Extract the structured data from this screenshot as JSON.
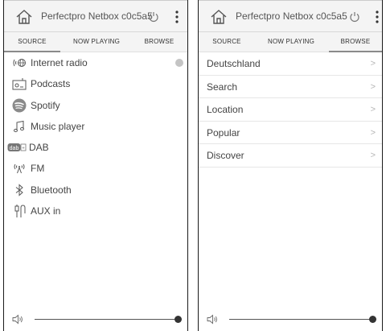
{
  "app": {
    "title": "Perfectpro Netbox c0c5a5"
  },
  "tabs": {
    "source": "SOURCE",
    "now_playing": "NOW PLAYING",
    "browse": "BROWSE"
  },
  "left": {
    "active_tab": "source",
    "sources": [
      {
        "label": "Internet radio",
        "icon": "internet-radio-icon",
        "active": true
      },
      {
        "label": "Podcasts",
        "icon": "podcasts-icon"
      },
      {
        "label": "Spotify",
        "icon": "spotify-icon"
      },
      {
        "label": "Music player",
        "icon": "music-note-icon"
      },
      {
        "label": "DAB",
        "icon": "dab-icon"
      },
      {
        "label": "FM",
        "icon": "fm-antenna-icon"
      },
      {
        "label": "Bluetooth",
        "icon": "bluetooth-icon"
      },
      {
        "label": "AUX in",
        "icon": "aux-in-icon"
      }
    ],
    "volume_level": 1.0
  },
  "right": {
    "active_tab": "browse",
    "browse_items": [
      {
        "label": "Deutschland"
      },
      {
        "label": "Search"
      },
      {
        "label": "Location"
      },
      {
        "label": "Popular"
      },
      {
        "label": "Discover"
      }
    ],
    "chevron": ">",
    "volume_level": 1.0
  },
  "colors": {
    "header_bg": "#f4f4f4",
    "accent_underline": "#8a8a8a",
    "active_dot": "#c4c4c4"
  }
}
